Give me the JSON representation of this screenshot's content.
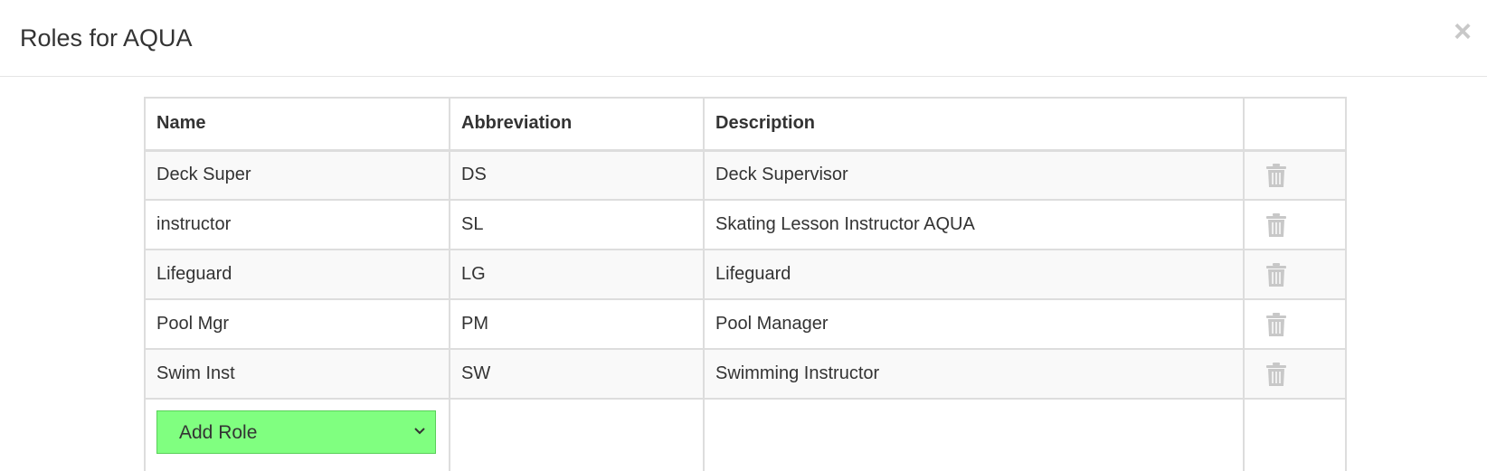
{
  "modal": {
    "title": "Roles for AQUA",
    "close_glyph": "×"
  },
  "table": {
    "headers": [
      "Name",
      "Abbreviation",
      "Description",
      ""
    ],
    "rows": [
      {
        "name": "Deck Super",
        "abbreviation": "DS",
        "description": "Deck Supervisor"
      },
      {
        "name": "instructor",
        "abbreviation": "SL",
        "description": "Skating Lesson Instructor AQUA"
      },
      {
        "name": "Lifeguard",
        "abbreviation": "LG",
        "description": "Lifeguard"
      },
      {
        "name": "Pool Mgr",
        "abbreviation": "PM",
        "description": "Pool Manager"
      },
      {
        "name": "Swim Inst",
        "abbreviation": "SW",
        "description": "Swimming Instructor"
      }
    ],
    "delete_icon": "trash-icon"
  },
  "add_role": {
    "selected": "Add Role",
    "background": "#80ff80"
  }
}
